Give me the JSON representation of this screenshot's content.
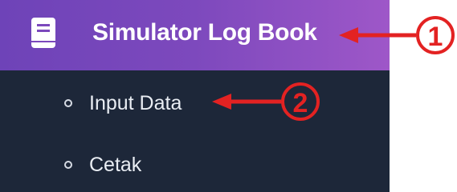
{
  "sidebar": {
    "header": {
      "label": "Simulator Log Book",
      "icon": "book-icon"
    },
    "items": [
      {
        "label": "Input Data",
        "icon": "circle-icon"
      },
      {
        "label": "Cetak",
        "icon": "circle-icon"
      }
    ]
  },
  "annotations": [
    {
      "number": "1",
      "color": "#e32222"
    },
    {
      "number": "2",
      "color": "#e32222"
    }
  ]
}
